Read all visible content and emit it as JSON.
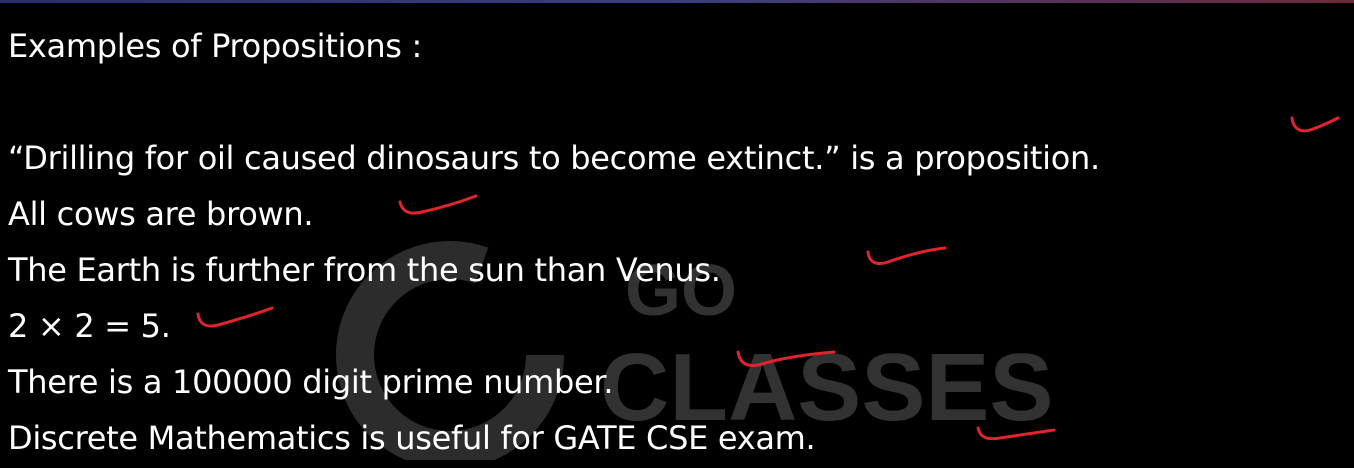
{
  "slide": {
    "title": "Examples of Propositions :",
    "examples": [
      "“Drilling for oil caused dinosaurs to become extinct.” is a proposition.",
      "All cows are brown.",
      "The Earth is further from the sun than Venus.",
      "2 × 2 = 5.",
      "There is a 100000 digit prime number.",
      "Discrete Mathematics is useful for GATE CSE exam."
    ]
  },
  "watermark": {
    "logo_letter": "G",
    "line1": "GO",
    "line2": "CLASSES"
  },
  "colors": {
    "background": "#000000",
    "text": "#ffffff",
    "annotation": "#e0242e",
    "watermark": "#3a3a3a"
  }
}
